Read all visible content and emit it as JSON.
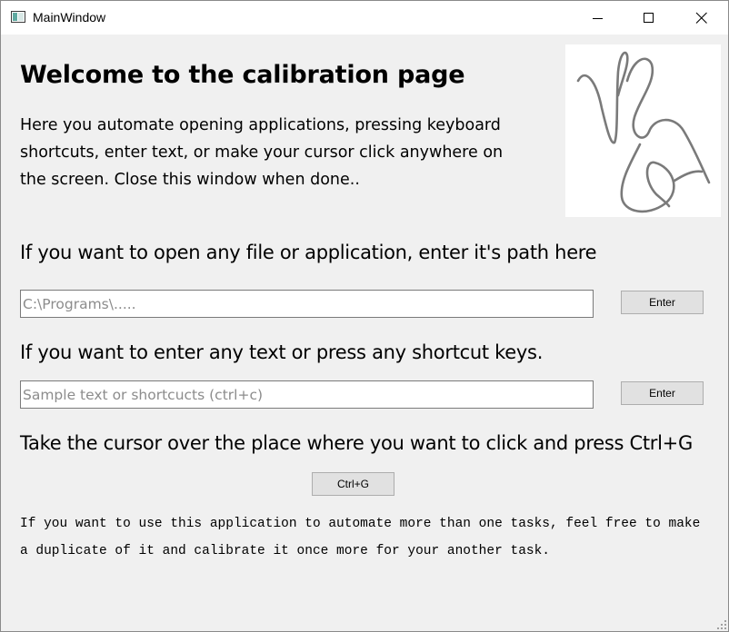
{
  "window": {
    "title": "MainWindow"
  },
  "header": {
    "heading": "Welcome to the calibration page",
    "intro": "Here you automate opening applications, pressing keyboard shortcuts, enter text, or make your cursor click anywhere on the screen. Close this window when done.."
  },
  "open_section": {
    "label": "If you want to open any file or application, enter it's  path here",
    "input_value": "",
    "input_placeholder": "C:\\Programs\\.....",
    "button_label": "Enter"
  },
  "text_section": {
    "label": "If you want to enter any text or press any shortcut keys.",
    "input_value": "",
    "input_placeholder": "Sample text or shortcucts (ctrl+c)",
    "button_label": "Enter"
  },
  "click_section": {
    "label": "Take the cursor over the place where you want to click and press Ctrl+G",
    "button_label": "Ctrl+G"
  },
  "footer": {
    "note": "If you want to use this application to automate more than one tasks, feel free to make a duplicate of it and calibrate it once more for your another task."
  },
  "icons": {
    "app": "window-app-icon",
    "minimize": "minimize-icon",
    "maximize": "maximize-icon",
    "close": "close-icon",
    "logo": "signature-logo",
    "resize": "resize-grip-icon"
  }
}
